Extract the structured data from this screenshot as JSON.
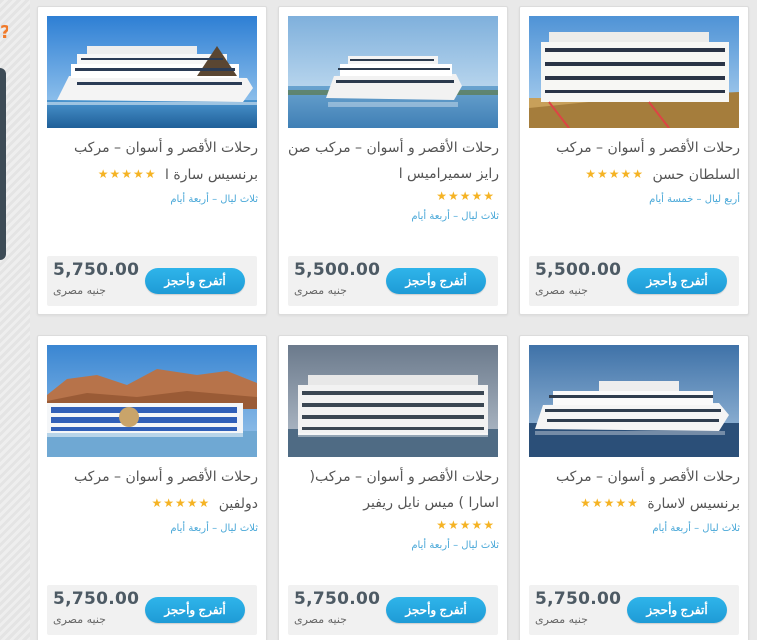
{
  "colors": {
    "accent": "#1e9bd6",
    "star": "#f5b324",
    "link": "#4aa8d8"
  },
  "left_accent": "?",
  "cards": [
    {
      "title": "رحلات الأقصر و أسوان – مركب برنسيس سارة ا",
      "rating": "★★★★★",
      "duration": "ثلاث ليال – أربعة أيام",
      "price": "5,750.00",
      "currency": "جنيه مصرى",
      "button": "أتفرج وأحجز"
    },
    {
      "title": "رحلات الأقصر و أسوان – مركب صن رايز سميراميس ا",
      "rating": "★★★★★",
      "duration": "ثلاث ليال – أربعة أيام",
      "price": "5,500.00",
      "currency": "جنيه مصرى",
      "button": "أتفرج وأحجز"
    },
    {
      "title": "رحلات الأقصر و أسوان – مركب السلطان حسن",
      "rating": "★★★★★",
      "duration": "أربع ليال – خمسة أيام",
      "price": "5,500.00",
      "currency": "جنيه مصرى",
      "button": "أتفرج وأحجز"
    },
    {
      "title": "رحلات الأقصر و أسوان – مركب دولفين",
      "rating": "★★★★★",
      "duration": "ثلاث ليال – أربعة أيام",
      "price": "5,750.00",
      "currency": "جنيه مصرى",
      "button": "أتفرج وأحجز"
    },
    {
      "title": "رحلات الأقصر و أسوان – مركب( اسارا ) ميس نايل ريفير",
      "rating": "★★★★★",
      "duration": "ثلاث ليال – أربعة أيام",
      "price": "5,750.00",
      "currency": "جنيه مصرى",
      "button": "أتفرج وأحجز"
    },
    {
      "title": "رحلات الأقصر و أسوان – مركب برنسيس لاسارة",
      "rating": "★★★★★",
      "duration": "ثلاث ليال – أربعة أيام",
      "price": "5,750.00",
      "currency": "جنيه مصرى",
      "button": "أتفرج وأحجز"
    }
  ]
}
